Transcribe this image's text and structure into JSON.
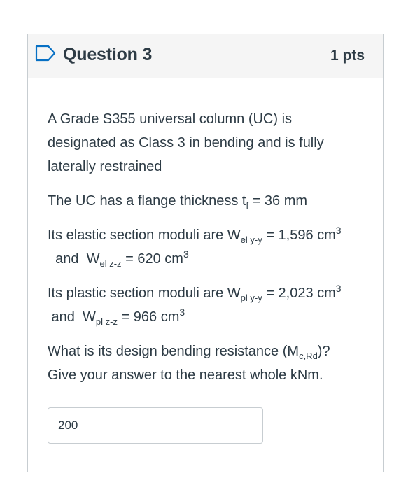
{
  "question": {
    "title": "Question 3",
    "points": "1 pts",
    "flag_icon": "flag-outline-icon",
    "paragraph1": "A Grade S355 universal column (UC) is designated as Class 3 in bending and is fully laterally restrained",
    "paragraph2": {
      "prefix": "The UC has a flange thickness t",
      "sub": "f",
      "suffix": " = 36 mm"
    },
    "paragraph3": {
      "prefix": "Its elastic section moduli are W",
      "sub1": "el y-y",
      "mid1": " = 1,596 cm",
      "sup1": "3",
      "mid2": "  and  W",
      "sub2": "el z-z",
      "mid3": " = 620 cm",
      "sup2": "3"
    },
    "paragraph4": {
      "prefix": "Its plastic section moduli are W",
      "sub1": "pl y-y",
      "mid1": " = 2,023 cm",
      "sup1": "3",
      "mid2": " and  W",
      "sub2": "pl z-z",
      "mid3": " = 966 cm",
      "sup2": "3"
    },
    "paragraph5": {
      "prefix": "What is its design bending resistance (M",
      "sub": "c,Rd",
      "suffix": ")? Give your answer to the nearest whole kNm."
    },
    "answer_value": "200"
  },
  "colors": {
    "text": "#2d3b45",
    "header_bg": "#f5f5f5",
    "border": "#c7cdd1",
    "flag_stroke": "#0770c4"
  }
}
